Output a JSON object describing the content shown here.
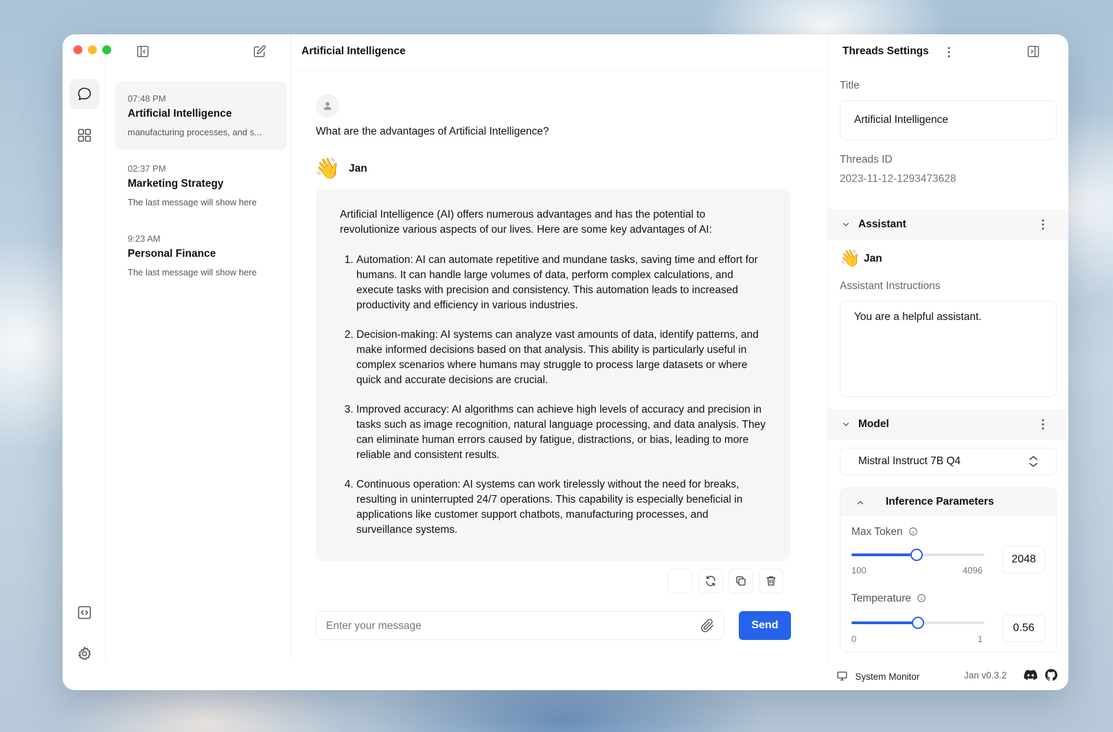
{
  "threads": [
    {
      "time": "07:48 PM",
      "title": "Artificial Intelligence",
      "last_message": "manufacturing processes, and s..."
    },
    {
      "time": "02:37 PM",
      "title": "Marketing Strategy",
      "last_message": "The last message will show here"
    },
    {
      "time": "9:23 AM",
      "title": "Personal Finance",
      "last_message": "The last message will show here"
    }
  ],
  "chat": {
    "title": "Artificial Intelligence",
    "user_message": "What are the advantages of Artificial Intelligence?",
    "assistant_name": "Jan",
    "assistant_emoji": "👋",
    "intro": "Artificial Intelligence (AI) offers numerous advantages and has the potential to revolutionize various aspects of our lives. Here are some key advantages of AI:",
    "points": [
      "Automation: AI can automate repetitive and mundane tasks, saving time and effort for humans. It can handle large volumes of data, perform complex calculations, and execute tasks with precision and consistency. This automation leads to increased productivity and efficiency in various industries.",
      "Decision-making: AI systems can analyze vast amounts of data, identify patterns, and make informed decisions based on that analysis. This ability is particularly useful in complex scenarios where humans may struggle to process large datasets or where quick and accurate decisions are crucial.",
      "Improved accuracy: AI algorithms can achieve high levels of accuracy and precision in tasks such as image recognition, natural language processing, and data analysis. They can eliminate human errors caused by fatigue, distractions, or bias, leading to more reliable and consistent results.",
      "Continuous operation: AI systems can work tirelessly without the need for breaks, resulting in uninterrupted 24/7 operations. This capability is especially beneficial in applications like customer support chatbots, manufacturing processes, and surveillance systems."
    ],
    "input_placeholder": "Enter your message",
    "send_label": "Send"
  },
  "settings": {
    "header": "Threads Settings",
    "title_label": "Title",
    "title_value": "Artificial Intelligence",
    "thread_id_label": "Threads ID",
    "thread_id_value": "2023-11-12-1293473628",
    "assistant_section": "Assistant",
    "assistant_name": "Jan",
    "assistant_emoji": "👋",
    "instructions_label": "Assistant Instructions",
    "instructions_value": "You are a helpful assistant.",
    "model_section": "Model",
    "model_value": "Mistral Instruct 7B Q4",
    "inference_section": "Inference Parameters",
    "max_token": {
      "label": "Max Token",
      "min": "100",
      "max": "4096",
      "value": "2048",
      "fraction": 0.49
    },
    "temperature": {
      "label": "Temperature",
      "min": "0",
      "max": "1",
      "value": "0.56",
      "fraction": 0.5
    }
  },
  "footer": {
    "system_monitor": "System Monitor",
    "version": "Jan v0.3.2"
  },
  "colors": {
    "accent": "#2563eb",
    "traffic_red": "#ff5f57",
    "traffic_yellow": "#febc2e",
    "traffic_green": "#28c840"
  }
}
